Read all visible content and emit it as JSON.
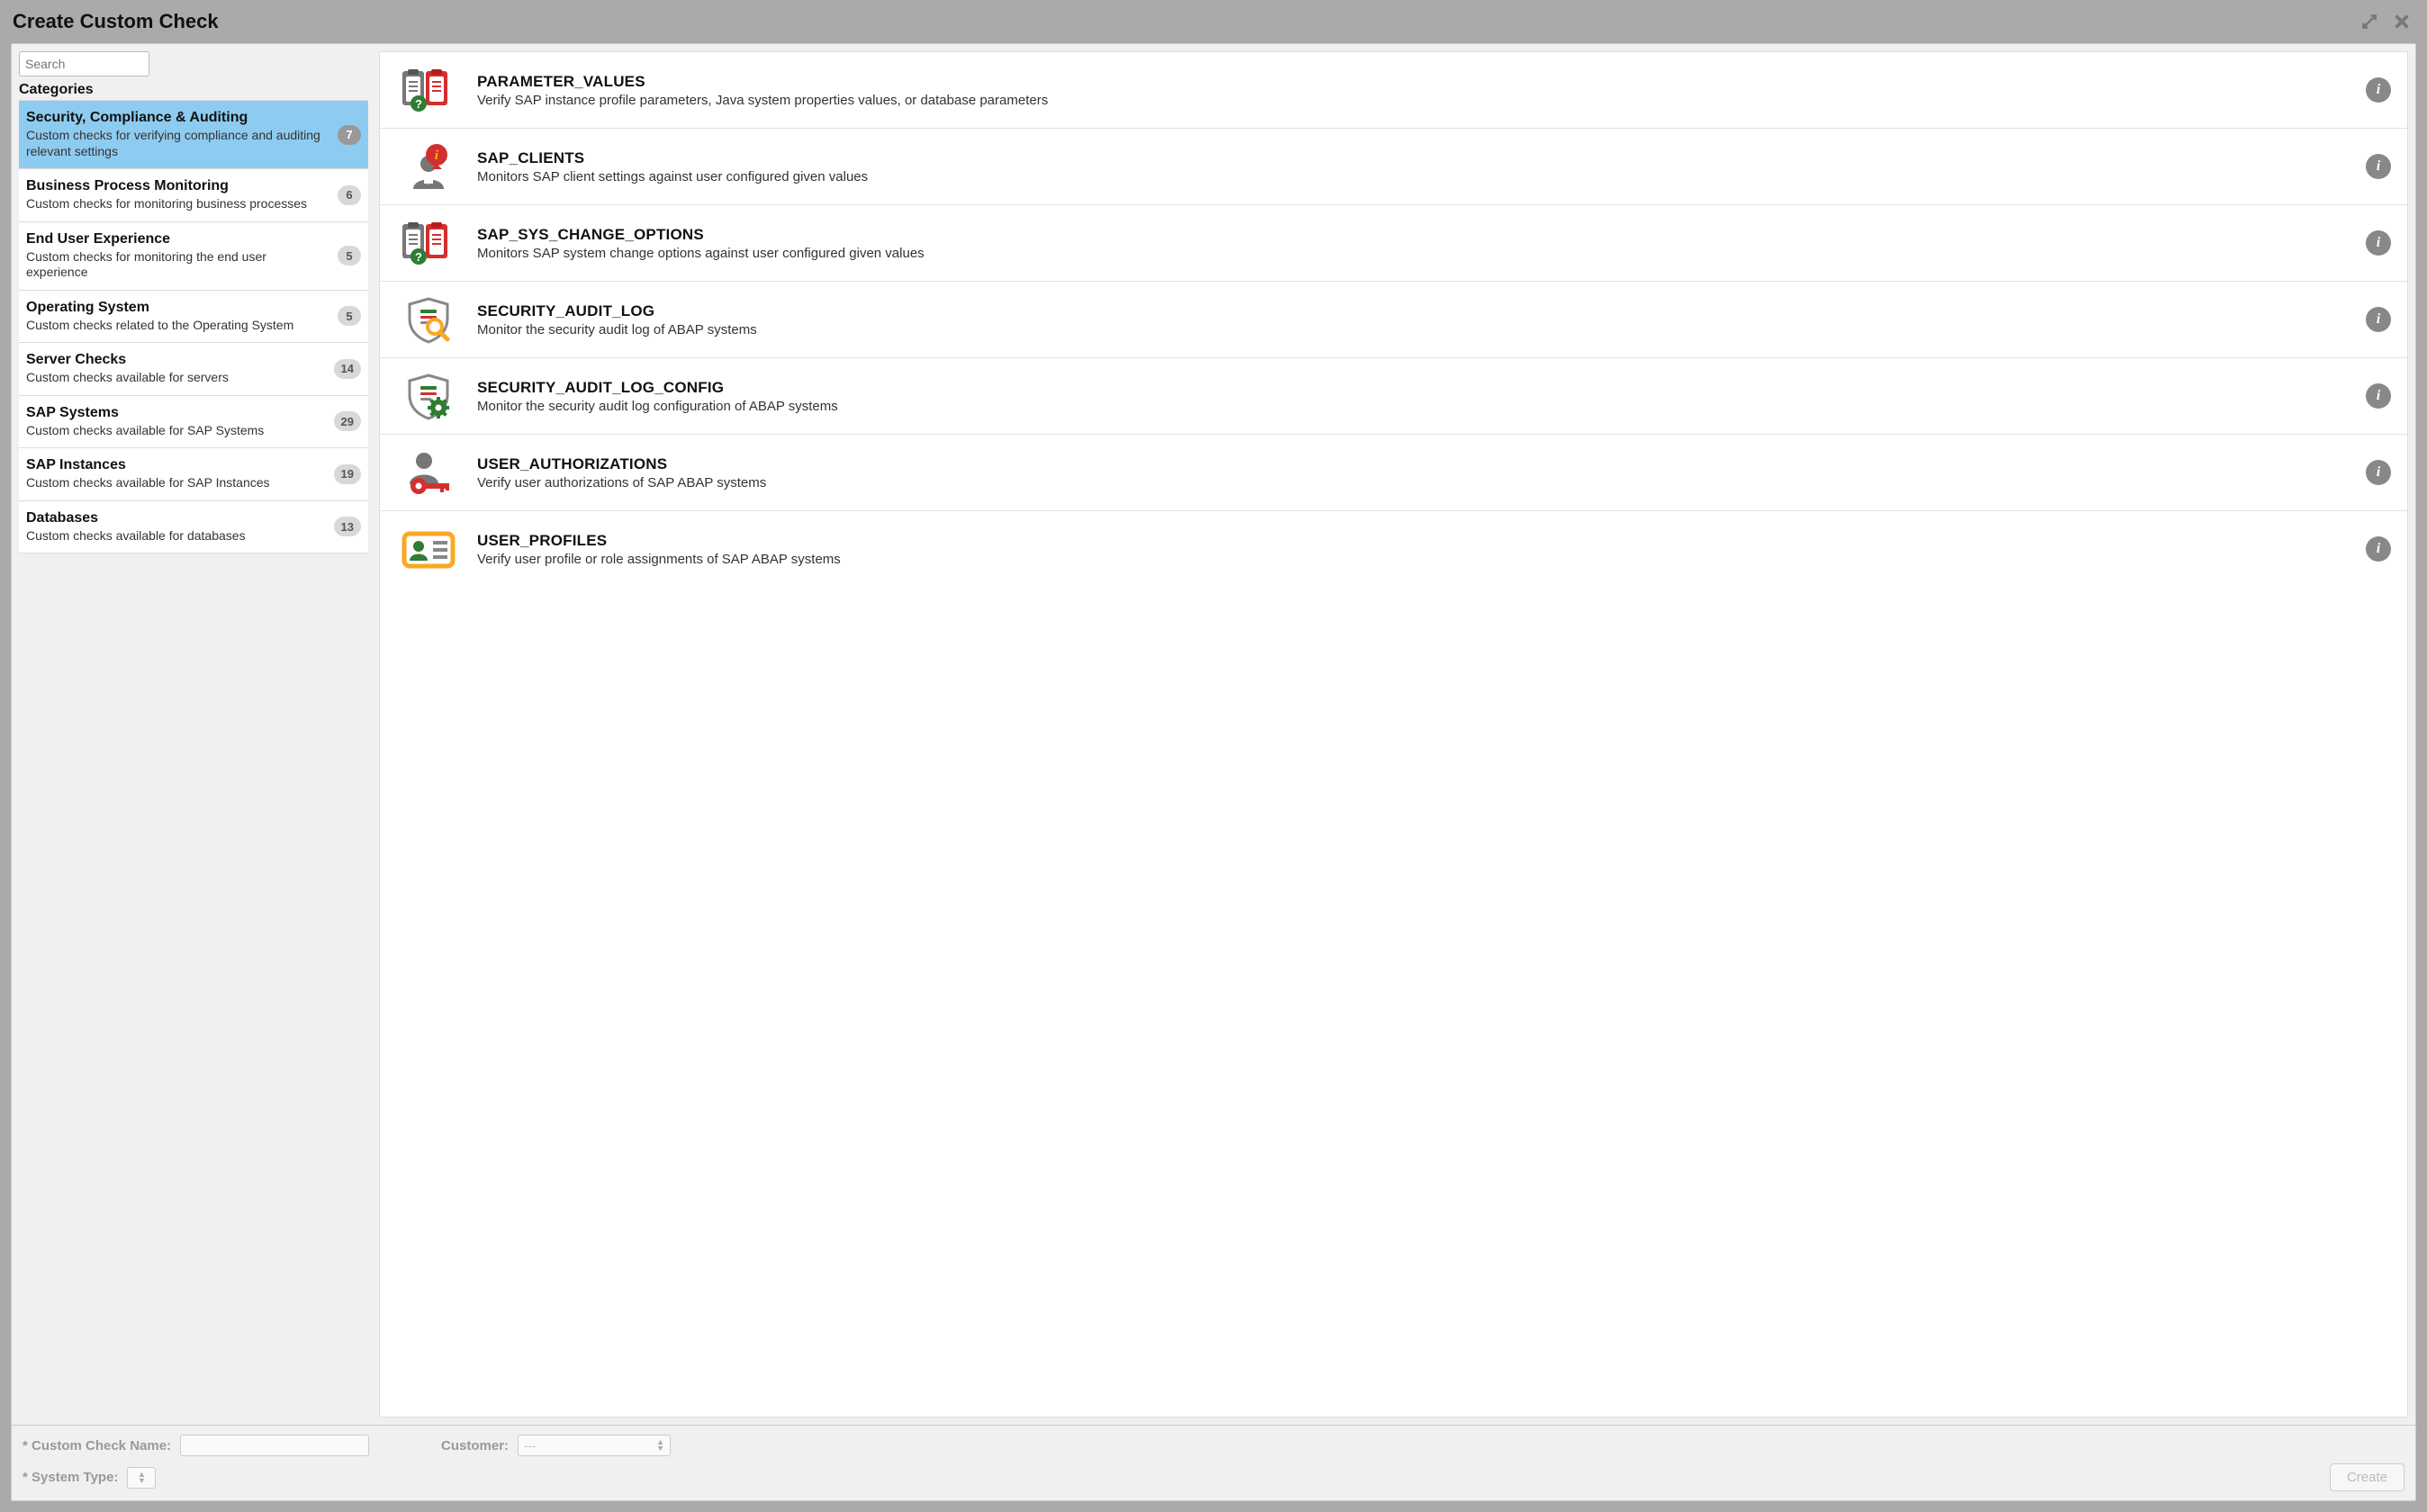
{
  "window": {
    "title": "Create Custom Check"
  },
  "search": {
    "placeholder": "Search"
  },
  "sidebar": {
    "heading": "Categories",
    "items": [
      {
        "title": "Security, Compliance & Auditing",
        "desc": "Custom checks for verifying compliance and auditing relevant settings",
        "count": "7",
        "selected": true
      },
      {
        "title": "Business Process Monitoring",
        "desc": "Custom checks for monitoring business processes",
        "count": "6",
        "selected": false
      },
      {
        "title": "End User Experience",
        "desc": "Custom checks for monitoring the end user experience",
        "count": "5",
        "selected": false
      },
      {
        "title": "Operating System",
        "desc": "Custom checks related to the Operating System",
        "count": "5",
        "selected": false
      },
      {
        "title": "Server Checks",
        "desc": "Custom checks available for servers",
        "count": "14",
        "selected": false
      },
      {
        "title": "SAP Systems",
        "desc": "Custom checks available for SAP Systems",
        "count": "29",
        "selected": false
      },
      {
        "title": "SAP Instances",
        "desc": "Custom checks available for SAP Instances",
        "count": "19",
        "selected": false
      },
      {
        "title": "Databases",
        "desc": "Custom checks available for databases",
        "count": "13",
        "selected": false
      }
    ]
  },
  "checks": [
    {
      "icon": "clipboards",
      "title": "PARAMETER_VALUES",
      "desc": "Verify SAP instance profile parameters, Java system properties values, or database parameters"
    },
    {
      "icon": "person-info",
      "title": "SAP_CLIENTS",
      "desc": "Monitors SAP client settings against user configured given values"
    },
    {
      "icon": "clipboards",
      "title": "SAP_SYS_CHANGE_OPTIONS",
      "desc": "Monitors SAP system change options against user configured given values"
    },
    {
      "icon": "shield-search",
      "title": "SECURITY_AUDIT_LOG",
      "desc": "Monitor the security audit log of ABAP systems"
    },
    {
      "icon": "shield-gear",
      "title": "SECURITY_AUDIT_LOG_CONFIG",
      "desc": "Monitor the security audit log configuration of ABAP systems"
    },
    {
      "icon": "user-key",
      "title": "USER_AUTHORIZATIONS",
      "desc": "Verify user authorizations of SAP ABAP systems"
    },
    {
      "icon": "id-card",
      "title": "USER_PROFILES",
      "desc": "Verify user profile or role assignments of SAP ABAP systems"
    }
  ],
  "footer": {
    "name_label": "* Custom Check Name:",
    "customer_label": "Customer:",
    "customer_value": "---",
    "systype_label": "* System Type:",
    "create_label": "Create"
  }
}
